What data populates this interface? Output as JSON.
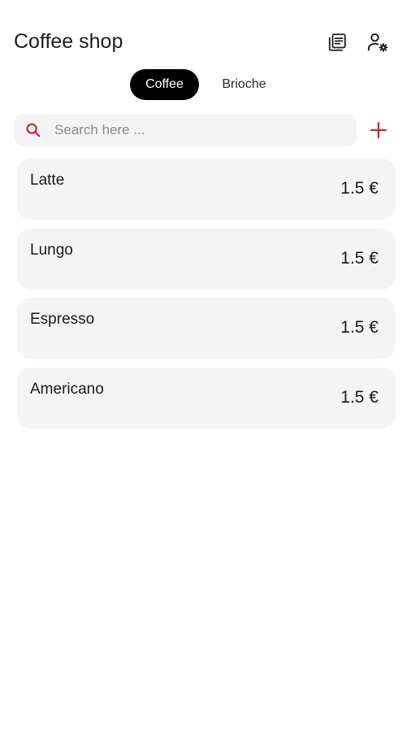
{
  "app_bar": {
    "title": "Coffee shop",
    "actions": [
      {
        "name": "orders",
        "icon": "receipt-list-icon"
      },
      {
        "name": "user-settings",
        "icon": "user-gear-icon"
      }
    ]
  },
  "tabs": [
    {
      "label": "Coffee",
      "active": true
    },
    {
      "label": "Brioche",
      "active": false
    }
  ],
  "search": {
    "placeholder": "Search here ...",
    "value": "",
    "icon": "search-icon"
  },
  "add_button": {
    "icon": "plus-icon"
  },
  "colors": {
    "accent": "#c62828",
    "active_tab_bg": "#000000",
    "card_bg": "#f5f5f5"
  },
  "products": [
    {
      "name": "Latte",
      "price": "1.5 €"
    },
    {
      "name": "Lungo",
      "price": "1.5 €"
    },
    {
      "name": "Espresso",
      "price": "1.5 €"
    },
    {
      "name": "Americano",
      "price": "1.5 €"
    }
  ]
}
